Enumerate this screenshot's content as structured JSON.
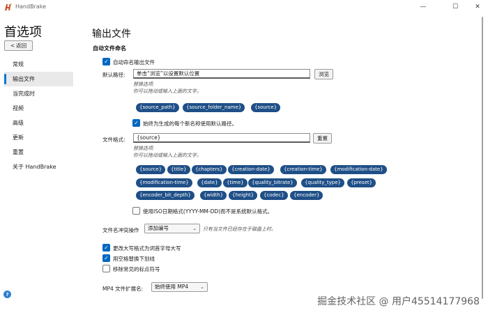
{
  "window": {
    "title": "HandBrake",
    "minimize": "—",
    "maximize": "☐",
    "close": "✕"
  },
  "sidebar": {
    "title": "首选项",
    "back_label": "返回",
    "back_glyph": "<",
    "items": [
      {
        "label": "常规"
      },
      {
        "label": "输出文件"
      },
      {
        "label": "当完成时"
      },
      {
        "label": "视频"
      },
      {
        "label": "高级"
      },
      {
        "label": "更新"
      },
      {
        "label": "重置"
      },
      {
        "label": "关于 HandBrake"
      }
    ],
    "active_index": 1,
    "help_glyph": "?"
  },
  "main": {
    "title": "输出文件",
    "section": "自动文件命名",
    "auto_name_label": "自动命名输出文件",
    "default_path_label": "默认路径:",
    "default_path_value": "单击“浏览”以设置默认位置",
    "browse_label": "浏览",
    "path_hint_line1": "替换选项:",
    "path_hint_line2": "你可以拖动或输入上面的文字。",
    "path_tags": [
      "{source_path}",
      "{source_folder_name}",
      "{source}"
    ],
    "always_default_path_label": "始终为生成的每个新名称使用默认路径。",
    "format_label": "文件格式:",
    "format_value": "{source}",
    "reset_label": "重置",
    "format_hint_line1": "替换选项:",
    "format_hint_line2": "你可以拖动或输入上面的文字。",
    "format_tags": [
      "{source}",
      "{title}",
      "{chapters}",
      "{creation-date}",
      "{creation-time}",
      "{modification-date}",
      "{modification-time}",
      "{date}",
      "{time}",
      "{quality_bitrate}",
      "{quality_type}",
      "{preset}",
      "{encoder_bit_depth}",
      "{width}",
      "{height}",
      "{codec}",
      "{encoder}"
    ],
    "iso_date_label": "使用ISO日期格式(YYYY-MM-DD)而不是系统默认格式。",
    "conflict_label": "文件名冲突操作",
    "conflict_value": "添加编号",
    "conflict_hint": "只有当文件已经存在于磁盘上时。",
    "capitalize_label": "更改大写格式为词首字母大写",
    "replace_spaces_label": "用空格替换下划线",
    "remove_punct_label": "移除常见的标点符号",
    "mp4_ext_label": "MP4 文件扩展名:",
    "mp4_ext_value": "始终使用 MP4",
    "checkmark": "✓",
    "chevron": "⌄"
  },
  "checkboxes": {
    "auto_name": true,
    "always_default_path": true,
    "iso_date": false,
    "capitalize": true,
    "replace_spaces": true,
    "remove_punct": false
  },
  "watermark": "掘金技术社区 @ 用户45514177968",
  "colors": {
    "accent": "#0067c0",
    "tag_bg": "#1f4f87",
    "nav_indicator": "#0078d4"
  }
}
